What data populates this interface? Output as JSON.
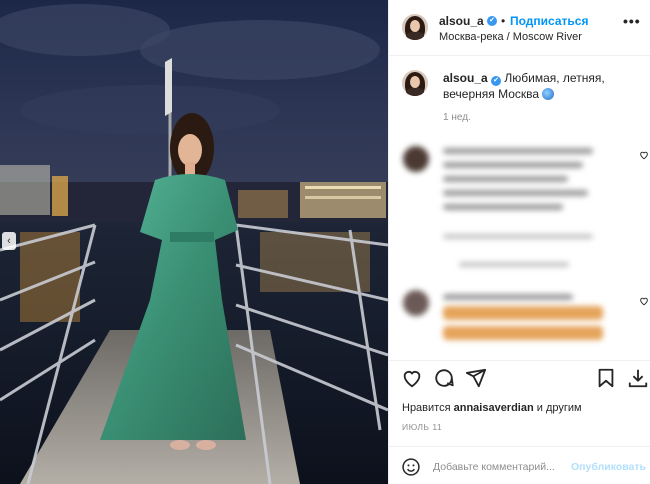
{
  "post": {
    "username": "alsou_a",
    "verified_mark": "✔",
    "separator": "•",
    "follow_label": "Подписаться",
    "location": "Москва-река / Moscow River",
    "more_label": "•••",
    "caption": "Любимая, летняя, вечерняя Москва",
    "caption_emoji": "globe-emoji",
    "age": "1 нед."
  },
  "photo": {
    "nav_prev": "‹",
    "description_colors": {
      "dress": "#3f9a7e",
      "sky": "#1d2540",
      "water": "#0f1624"
    }
  },
  "comments": [
    {
      "username": "blurred",
      "text": "blurred",
      "liked": false
    },
    {
      "username": "blurred",
      "text": "blurred",
      "liked": false
    }
  ],
  "footer": {
    "likes_prefix": "Нравится",
    "likes_user": "annaisaverdian",
    "likes_suffix": "и другим",
    "date": "ИЮЛЬ 11",
    "comment_placeholder": "Добавьте комментарий...",
    "publish_label": "Опубликовать"
  },
  "icons": [
    "heart-icon",
    "comment-icon",
    "share-icon",
    "bookmark-icon",
    "download-icon",
    "smile-icon"
  ],
  "colors": {
    "accent": "#0095f6",
    "publish_disabled": "#b2dffc",
    "verified": "#3897f0"
  }
}
